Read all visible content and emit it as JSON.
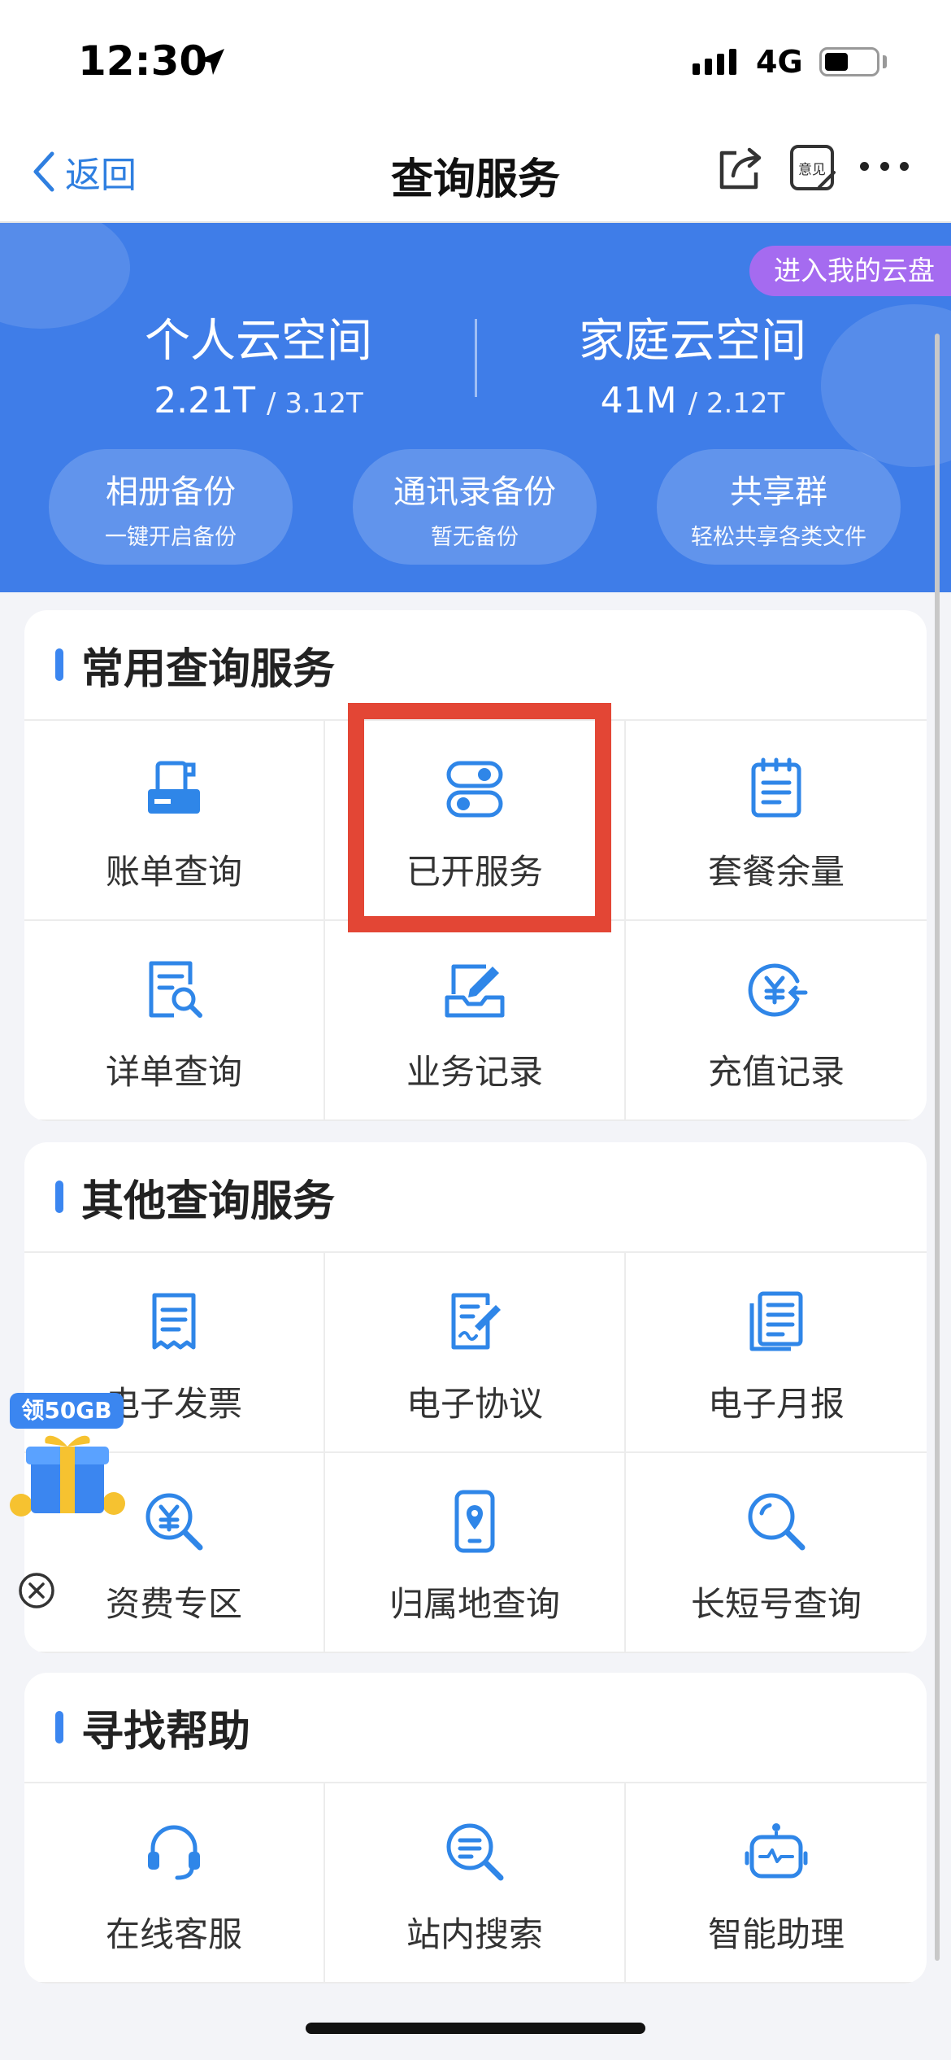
{
  "status_bar": {
    "time": "12:30",
    "network": "4G"
  },
  "nav": {
    "back_label": "返回",
    "title": "查询服务",
    "feedback_label": "意见"
  },
  "banner": {
    "cloud_link": "进入我的云盘",
    "personal": {
      "title": "个人云空间",
      "used": "2.21T",
      "total": "3.12T"
    },
    "family": {
      "title": "家庭云空间",
      "used": "41M",
      "total": "2.12T"
    },
    "pills": [
      {
        "title": "相册备份",
        "sub": "一键开启备份"
      },
      {
        "title": "通讯录备份",
        "sub": "暂无备份"
      },
      {
        "title": "共享群",
        "sub": "轻松共享各类文件"
      }
    ]
  },
  "common": {
    "title": "常用查询服务",
    "items": [
      {
        "label": "账单查询",
        "icon": "printer-bill-icon"
      },
      {
        "label": "已开服务",
        "icon": "toggle-switch-icon"
      },
      {
        "label": "套餐余量",
        "icon": "notepad-icon"
      },
      {
        "label": "详单查询",
        "icon": "document-search-icon"
      },
      {
        "label": "业务记录",
        "icon": "edit-tray-icon"
      },
      {
        "label": "充值记录",
        "icon": "yen-refresh-icon"
      }
    ]
  },
  "other": {
    "title": "其他查询服务",
    "items": [
      {
        "label": "电子发票",
        "icon": "receipt-icon"
      },
      {
        "label": "电子协议",
        "icon": "contract-sign-icon"
      },
      {
        "label": "电子月报",
        "icon": "report-stack-icon"
      },
      {
        "label": "资费专区",
        "icon": "yen-search-icon"
      },
      {
        "label": "归属地查询",
        "icon": "phone-location-icon"
      },
      {
        "label": "长短号查询",
        "icon": "magnifier-icon"
      }
    ]
  },
  "help": {
    "title": "寻找帮助",
    "items": [
      {
        "label": "在线客服",
        "icon": "headset-icon"
      },
      {
        "label": "站内搜索",
        "icon": "search-list-icon"
      },
      {
        "label": "智能助理",
        "icon": "robot-icon"
      }
    ]
  },
  "gift": {
    "badge": "领50GB"
  },
  "colors": {
    "primary": "#3f7de8",
    "accent_purple": "#a56bf0",
    "highlight_red": "#e34635",
    "icon_blue": "#2f86e8"
  }
}
